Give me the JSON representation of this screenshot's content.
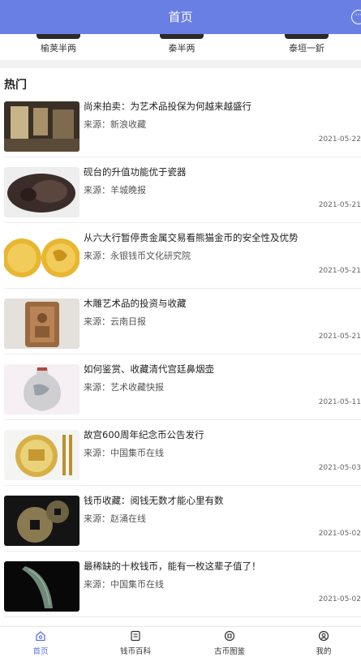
{
  "header": {
    "title": "首页",
    "more_icon": "more-icon"
  },
  "coin_categories": [
    {
      "label": "榆荚半两"
    },
    {
      "label": "秦半两"
    },
    {
      "label": "泰垣一釿"
    }
  ],
  "hot": {
    "title": "热门",
    "source_prefix": "来源：",
    "articles": [
      {
        "headline": "尚来拍卖：为艺术品投保为何越来越盛行",
        "source": "新浪收藏",
        "date": "2021-05-22"
      },
      {
        "headline": "砚台的升值功能优于瓷器",
        "source": "羊城晚报",
        "date": "2021-05-21"
      },
      {
        "headline": "从六大行暂停贵金属交易看熊猫金币的安全性及优势",
        "source": "永银钱币文化研究院",
        "date": "2021-05-21"
      },
      {
        "headline": "木雕艺术品的投资与收藏",
        "source": "云南日报",
        "date": "2021-05-21"
      },
      {
        "headline": "如何鉴赏、收藏清代宫廷鼻烟壶",
        "source": "艺术收藏快报",
        "date": "2021-05-11"
      },
      {
        "headline": "故宫600周年纪念币公告发行",
        "source": "中国集币在线",
        "date": "2021-05-03"
      },
      {
        "headline": "钱币收藏：阅钱无数才能心里有数",
        "source": "赵涌在线",
        "date": "2021-05-02"
      },
      {
        "headline": "最稀缺的十枚钱币，能有一枚这辈子值了！",
        "source": "中国集币在线",
        "date": "2021-05-02"
      }
    ]
  },
  "tabs": [
    {
      "label": "首页",
      "icon": "home-icon",
      "active": true
    },
    {
      "label": "钱币百科",
      "icon": "book-icon",
      "active": false
    },
    {
      "label": "古币图鉴",
      "icon": "coin-icon",
      "active": false
    },
    {
      "label": "我的",
      "icon": "user-icon",
      "active": false
    }
  ],
  "colors": {
    "accent": "#6a7fe4",
    "active_tab": "#5b72e6"
  }
}
